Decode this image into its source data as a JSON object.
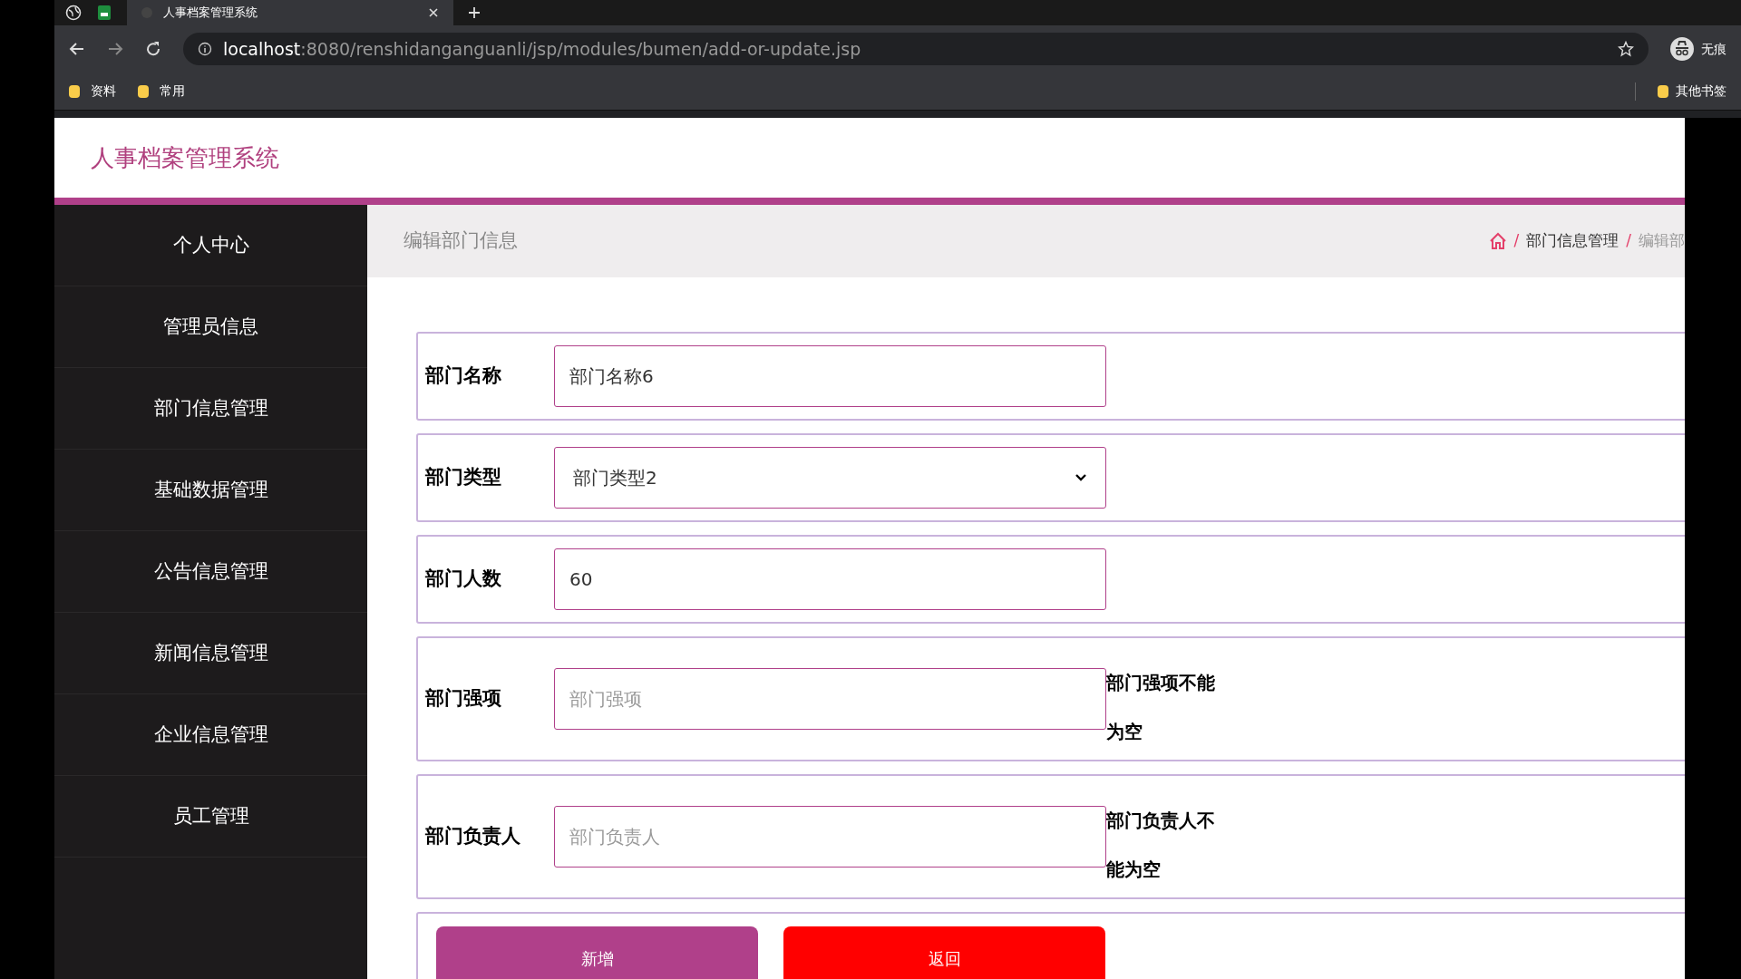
{
  "browser": {
    "tab_title": "人事档案管理系统",
    "url_host": "localhost",
    "url_rest": ":8080/renshidanganguanli/jsp/modules/bumen/add-or-update.jsp",
    "bookmarks": [
      "资料",
      "常用"
    ],
    "other_bookmarks": "其他书签",
    "profile_label": "无痕"
  },
  "header": {
    "title": "人事档案管理系统"
  },
  "sidebar": {
    "items": [
      {
        "label": "个人中心",
        "selected": false
      },
      {
        "label": "管理员信息",
        "selected": false
      },
      {
        "label": "部门信息管理",
        "selected": false
      },
      {
        "label": "基础数据管理",
        "selected": false
      },
      {
        "label": "公告信息管理",
        "selected": false
      },
      {
        "label": "新闻信息管理",
        "selected": false
      },
      {
        "label": "企业信息管理",
        "selected": false
      },
      {
        "label": "员工管理",
        "selected": false
      }
    ]
  },
  "page_title": "编辑部门信息",
  "breadcrumb": {
    "separator": "/",
    "items": [
      "部门信息管理",
      "编辑部"
    ]
  },
  "form": {
    "fields": [
      {
        "label": "部门名称",
        "kind": "input",
        "value": "部门名称6"
      },
      {
        "label": "部门类型",
        "kind": "select",
        "value": "部门类型2"
      },
      {
        "label": "部门人数",
        "kind": "input",
        "value": "60"
      },
      {
        "label": "部门强项",
        "kind": "input",
        "placeholder": "部门强项",
        "error": "部门强项不能为空"
      },
      {
        "label": "部门负责人",
        "kind": "input",
        "placeholder": "部门负责人",
        "error": "部门负责人不能为空"
      }
    ],
    "buttons": [
      {
        "label": "新增",
        "kind": "primary"
      },
      {
        "label": "返回",
        "kind": "danger"
      }
    ]
  }
}
